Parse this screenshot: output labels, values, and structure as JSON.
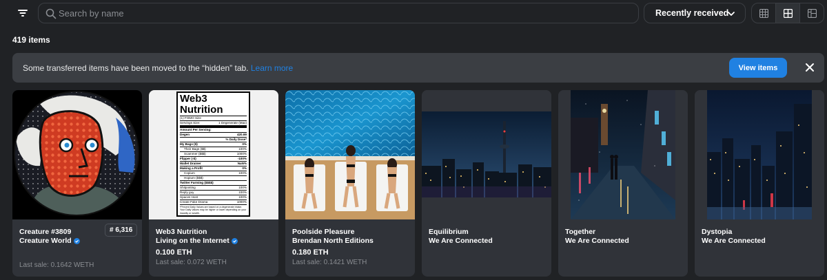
{
  "search": {
    "placeholder": "Search by name"
  },
  "sort": {
    "label": "Recently received"
  },
  "items_count": "419 items",
  "banner": {
    "text": "Some transferred items have been moved to the “hidden” tab. ",
    "link": "Learn more",
    "button": "View items"
  },
  "cards": [
    {
      "name": "Creature #3809",
      "collection": "Creature World",
      "verified": true,
      "rarity": "# 6,316",
      "price": "",
      "last_sale": "Last sale: 0.1642 WETH"
    },
    {
      "name": "Web3 Nutrition",
      "collection": "Living on the Internet",
      "verified": true,
      "price": "0.100 ETH",
      "last_sale": "Last sale: 0.072 WETH"
    },
    {
      "name": "Poolside Pleasure",
      "collection": "Brendan North Editions",
      "verified": false,
      "price": "0.180 ETH",
      "last_sale": "Last sale: 0.1421 WETH"
    },
    {
      "name": "Equilibrium",
      "collection": "We Are Connected",
      "verified": false,
      "price": "",
      "last_sale": ""
    },
    {
      "name": "Together",
      "collection": "We Are Connected",
      "verified": false,
      "price": "",
      "last_sale": ""
    },
    {
      "name": "Dystopia",
      "collection": "We Are Connected",
      "verified": false,
      "price": "",
      "last_sale": ""
    }
  ],
  "nutrition": {
    "title": "Web3 Nutrition",
    "serving1": "(1) FOMO Size",
    "serving2": "Servings Size:",
    "serving2_val": "1 Degenerate (Max)",
    "amount": "Amount Per Serving:",
    "degen": "Degen",
    "degen_val": "420.69",
    "dv": "% Daily Dose*",
    "rows": [
      [
        "My Bags ($)",
        "0%"
      ],
      [
        "Their Bags ($$)",
        "100%"
      ],
      [
        "Scammer ($$$)",
        "1000%"
      ],
      [
        "Flipper (-$)",
        "-100%"
      ],
      [
        "Wallet Drainer",
        "NaN%"
      ],
      [
        "Making a Profit",
        "0%"
      ],
      [
        "Copium",
        "100%"
      ],
      [
        "Hopium ($$$)",
        ""
      ],
      [
        "Twitter Farming ($$$$)",
        ""
      ],
      [
        "Shitposting",
        "100%"
      ],
      [
        "Reply guy",
        "100%"
      ],
      [
        "Spaces Host",
        "100%"
      ],
      [
        "Create Fake Drama",
        "1000%"
      ]
    ],
    "footnote": "*Percent Daily Values are based on a degenerate intake. Your Daily Values may be higher or lower depending on your insanity or wealth."
  },
  "colors": {
    "background": "#202225",
    "card": "#303339",
    "accent": "#2081e2",
    "banner": "#3b3e43"
  },
  "icons": [
    "filter-icon",
    "search-icon",
    "chevron-down-icon",
    "grid-small-icon",
    "grid-large-icon",
    "grid-compact-icon",
    "close-icon",
    "verified-icon"
  ]
}
